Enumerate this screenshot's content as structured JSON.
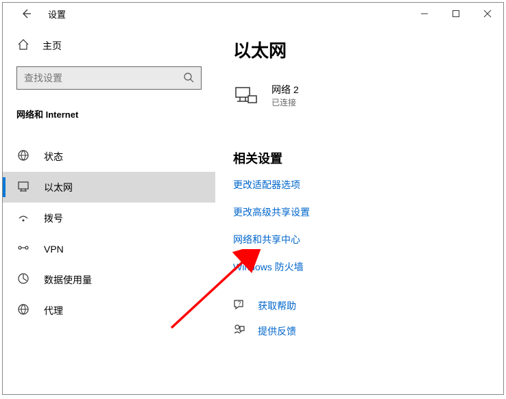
{
  "window": {
    "title": "设置"
  },
  "sidebar": {
    "home_label": "主页",
    "search_placeholder": "查找设置",
    "category": "网络和 Internet",
    "items": [
      {
        "label": "状态",
        "selected": false
      },
      {
        "label": "以太网",
        "selected": true
      },
      {
        "label": "拨号",
        "selected": false
      },
      {
        "label": "VPN",
        "selected": false
      },
      {
        "label": "数据使用量",
        "selected": false
      },
      {
        "label": "代理",
        "selected": false
      }
    ]
  },
  "main": {
    "title": "以太网",
    "network": {
      "name": "网络 2",
      "status": "已连接"
    },
    "related_section_title": "相关设置",
    "links": [
      "更改适配器选项",
      "更改高级共享设置",
      "网络和共享中心",
      "Windows 防火墙"
    ],
    "help_links": [
      "获取帮助",
      "提供反馈"
    ]
  }
}
